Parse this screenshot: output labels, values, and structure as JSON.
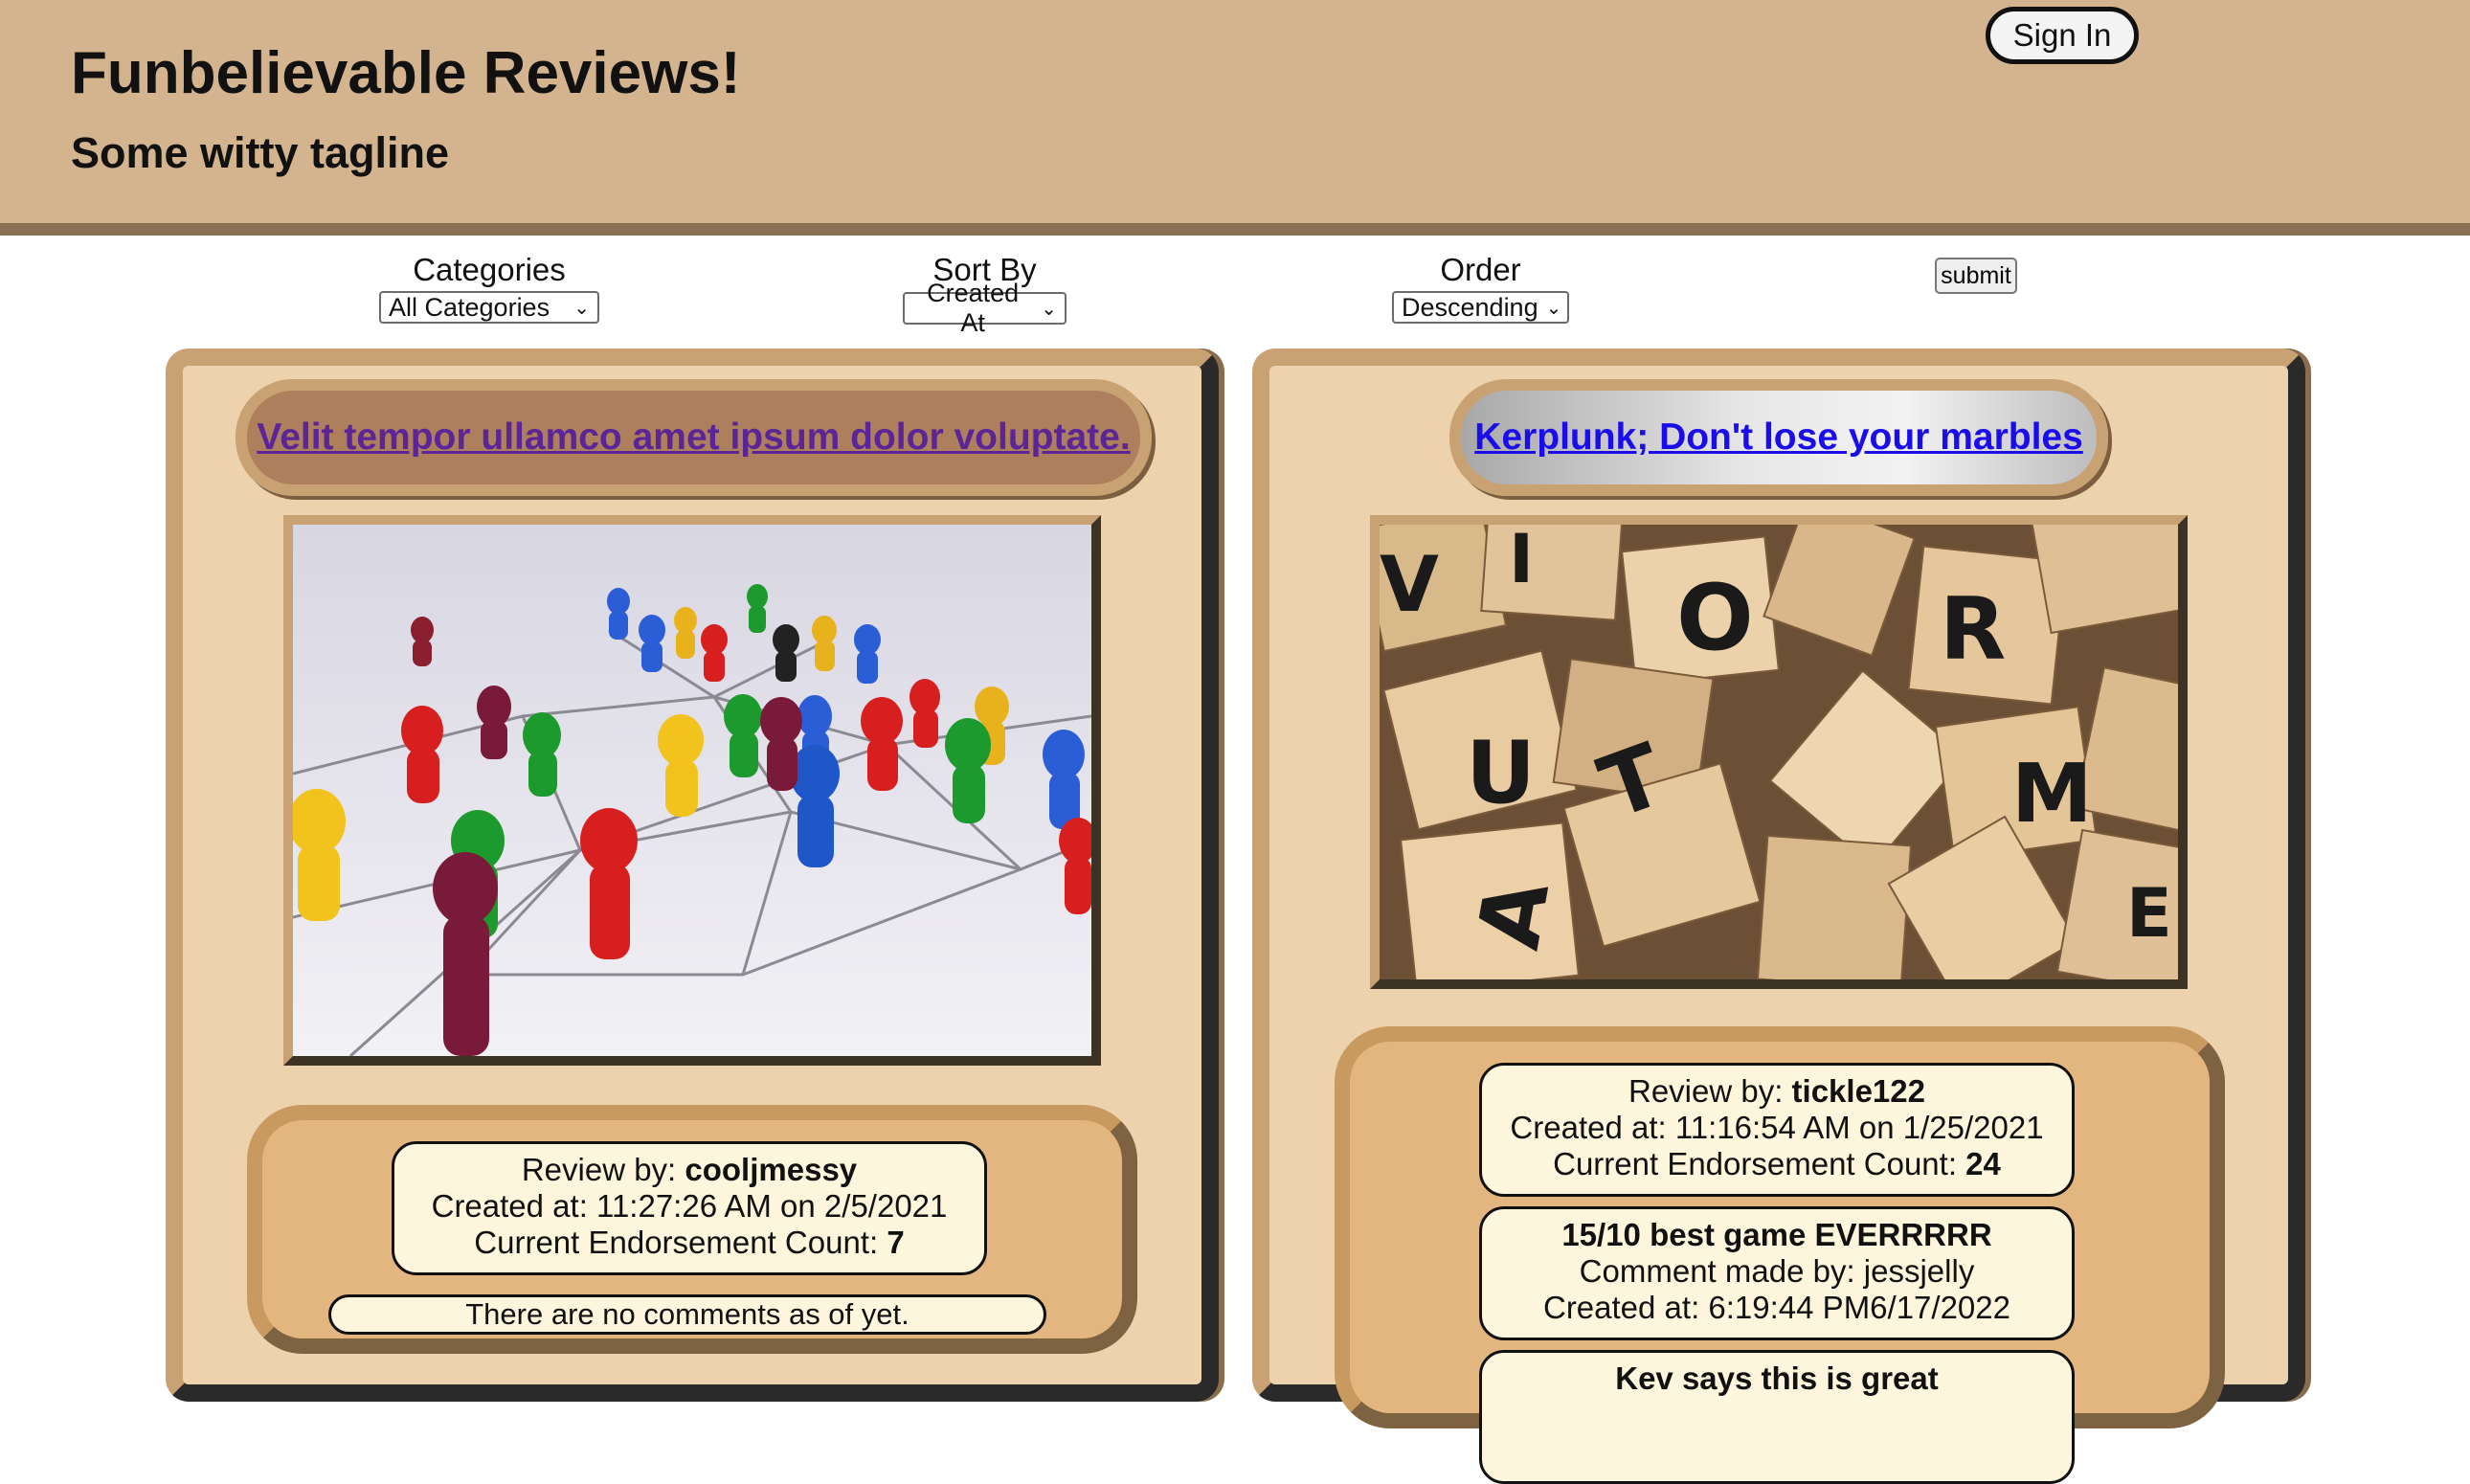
{
  "header": {
    "title": "Funbelievable Reviews!",
    "tagline": "Some witty tagline",
    "sign_in": "Sign In"
  },
  "filters": {
    "categories_label": "Categories",
    "categories_value": "All Categories",
    "sort_label": "Sort By",
    "sort_value": "Created At",
    "order_label": "Order",
    "order_value": "Descending",
    "submit": "submit"
  },
  "reviews": [
    {
      "title": "Velit tempor ullamco amet ipsum dolor voluptate.",
      "image": "board-game-pawns",
      "review_by_label": "Review by:",
      "owner": "cooljmessy",
      "created": "Created at: 11:27:26 AM on 2/5/2021",
      "endorse_label": "Current Endorsement Count:",
      "votes": "7",
      "no_comments": "There are no comments as of yet."
    },
    {
      "title": "Kerplunk; Don't lose your marbles",
      "image": "scrabble-tiles",
      "review_by_label": "Review by:",
      "owner": "tickle122",
      "created": "Created at: 11:16:54 AM on 1/25/2021",
      "endorse_label": "Current Endorsement Count:",
      "votes": "24",
      "comments": [
        {
          "body": "15/10 best game EVERRRRR",
          "author": "Comment made by: jessjelly",
          "created": "Created at: 6:19:44 PM6/17/2022"
        },
        {
          "body": "Kev says this is great"
        }
      ]
    }
  ],
  "colors": {
    "header_bg": "#d3b48f",
    "card_bg": "#edd2ae",
    "visited_link": "#5b2597",
    "link": "#1a0dea",
    "meta_bg": "#fdf6dd"
  }
}
